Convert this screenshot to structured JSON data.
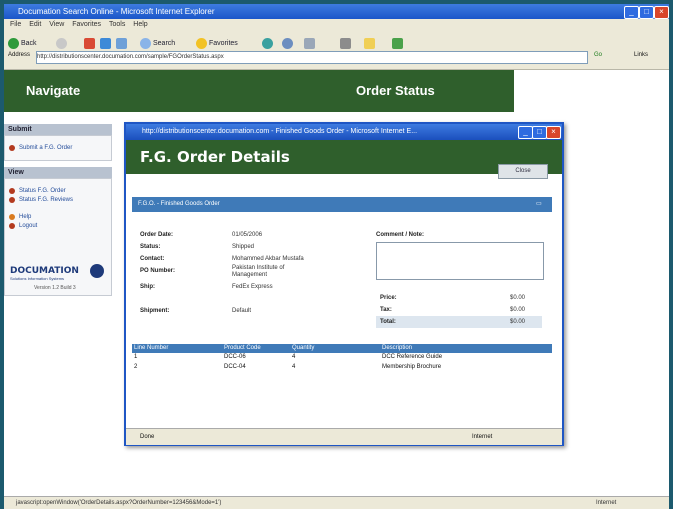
{
  "browser": {
    "title": "Documation Search Online - Microsoft Internet Explorer",
    "menu": [
      "File",
      "Edit",
      "View",
      "Favorites",
      "Tools",
      "Help"
    ],
    "toolbar": {
      "back": "Back",
      "search": "Search",
      "favorites": "Favorites"
    },
    "address_label": "Address",
    "address_value": "http://distributionscenter.documation.com/sample/FGOrderStatus.aspx",
    "go_label": "Go",
    "links_label": "Links",
    "status_text": "javascript:openWindow('OrderDetails.aspx?OrderNumber=123456&Mode=1')",
    "zone_text": "Internet"
  },
  "page": {
    "nav_title": "Navigate",
    "header_title": "Order Status"
  },
  "sidebar": {
    "submit_header": "Submit",
    "submit_item": "Submit a F.G. Order",
    "view_header": "View",
    "view_items": [
      "Status F.G. Order",
      "Status F.G. Reviews"
    ],
    "help_item": "Help",
    "logout_item": "Logout",
    "logo_text": "DOCUMATION",
    "logo_sub": "Solutions Information Systems",
    "version": "Version 1.2 Build 3"
  },
  "popup": {
    "title": "http://distributionscenter.documation.com - Finished Goods Order - Microsoft Internet E...",
    "heading": "F.G. Order Details",
    "close_label": "Close",
    "section_title": "F.G.O. - Finished Goods Order",
    "fields": [
      {
        "label": "Order Date:",
        "value": "01/05/2006"
      },
      {
        "label": "Status:",
        "value": "Shipped"
      },
      {
        "label": "Contact:",
        "value": "Mohammed Akbar Mustafa"
      },
      {
        "label": "PO Number:",
        "value": "Pakistan Institute of Management"
      },
      {
        "label": "Ship:",
        "value": "FedEx Express"
      }
    ],
    "shipment_label": "Shipment:",
    "shipment_value": "Default",
    "comments_label": "Comment / Note:",
    "totals": [
      {
        "label": "Price:",
        "value": "$0.00"
      },
      {
        "label": "Tax:",
        "value": "$0.00"
      },
      {
        "label": "Total:",
        "value": "$0.00"
      }
    ],
    "table": {
      "columns": [
        "Line Number",
        "Product Code",
        "Quantity",
        "Description"
      ],
      "rows": [
        [
          "1",
          "DCC-06",
          "4",
          "DCC Reference Guide"
        ],
        [
          "2",
          "DCC-04",
          "4",
          "Membership Brochure"
        ]
      ]
    },
    "status_done": "Done",
    "status_zone": "Internet"
  }
}
